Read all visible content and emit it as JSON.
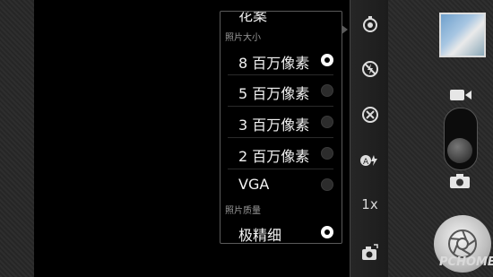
{
  "menu": {
    "top_partial_label": "花案",
    "size_header": "照片大小",
    "size_options": [
      {
        "label": "8 百万像素",
        "selected": true
      },
      {
        "label": "5 百万像素",
        "selected": false
      },
      {
        "label": "3 百万像素",
        "selected": false
      },
      {
        "label": "2 百万像素",
        "selected": false
      },
      {
        "label": "VGA",
        "selected": false
      }
    ],
    "quality_header": "照片质量",
    "quality_option": {
      "label": "极精细",
      "selected": true
    }
  },
  "sidebar": {
    "icons": [
      "settings-icon",
      "flash-off-icon",
      "focus-icon",
      "scene-icon",
      "zoom-indicator",
      "camera-switch-icon"
    ],
    "zoom_label": "1x"
  },
  "right_panel": {
    "mode_icons": [
      "video-camera-icon",
      "camera-icon"
    ]
  },
  "watermark": "PCHOME"
}
